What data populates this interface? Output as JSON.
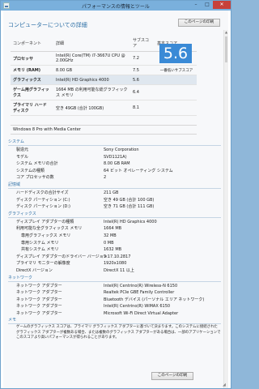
{
  "window": {
    "title": "パフォーマンスの情報とツール",
    "min": "–",
    "max": "□",
    "close": "✕"
  },
  "page": {
    "heading": "コンピューターについての詳細",
    "print_button": "このページの印刷"
  },
  "score_table": {
    "headers": [
      "コンポーネント",
      "詳細",
      "サブスコア",
      "基本スコア"
    ],
    "rows": [
      {
        "component": "プロセッサ",
        "detail": "Intel(R) Core(TM) i7-3667U CPU @ 2.00GHz",
        "score": "7.2"
      },
      {
        "component": "メモリ (RAM)",
        "detail": "8.00 GB",
        "score": "7.5"
      },
      {
        "component": "グラフィックス",
        "detail": "Intel(R) HD Graphics 4000",
        "score": "5.6"
      },
      {
        "component": "ゲーム用グラフィックス",
        "detail": "1664 MB の利用可能な総グラフィックス メモリ",
        "score": "6.4"
      },
      {
        "component": "プライマリ ハード ディスク",
        "detail": "空き 49GB (合計 100GB)",
        "score": "8.1"
      }
    ],
    "base_score": "5.6",
    "base_caption": "一番低いサブスコア",
    "edition": "Windows 8 Pro with Media Center"
  },
  "sections": [
    {
      "title": "システム",
      "rows": [
        {
          "k": "製造元",
          "v": "Sony Corporation"
        },
        {
          "k": "モデル",
          "v": "SVD1121A)"
        },
        {
          "k": "システム メモリの合計",
          "v": "8.00 GB RAM"
        },
        {
          "k": "システムの種類",
          "v": "64 ビット オペレーティング システム"
        },
        {
          "k": "コア プロセッサの数",
          "v": "2"
        }
      ]
    },
    {
      "title": "記憶域",
      "rows": [
        {
          "k": "ハードディスクの合計サイズ",
          "v": "211 GB"
        },
        {
          "k": "ディスク パーティション (C:)",
          "v": "空き 49 GB (合計 100 GB)"
        },
        {
          "k": "ディスク パーティション (D:)",
          "v": "空き 71 GB (合計 111 GB)"
        }
      ]
    },
    {
      "title": "グラフィックス",
      "rows": [
        {
          "k": "ディスプレイ アダプターの種類",
          "v": "Intel(R) HD Graphics 4000"
        },
        {
          "k": "利用可能な全グラフィックス メモリ",
          "v": "1664 MB"
        },
        {
          "k": "専用グラフィックス メモリ",
          "v": "32 MB",
          "sub": true
        },
        {
          "k": "専用システム メモリ",
          "v": "0 MB",
          "sub": true
        },
        {
          "k": "共有システム メモリ",
          "v": "1632 MB",
          "sub": true
        },
        {
          "k": "ディスプレイ アダプターのドライバー バージョン",
          "v": "9.17.10.2817"
        },
        {
          "k": "プライマリ モニターの解像度",
          "v": "1920x1080"
        },
        {
          "k": "DirectX バージョン",
          "v": "DirectX 11 以上"
        }
      ]
    },
    {
      "title": "ネットワーク",
      "rows": [
        {
          "k": "ネットワーク アダプター",
          "v": "Intel(R) Centrino(R) Wireless-N 6150"
        },
        {
          "k": "ネットワーク アダプター",
          "v": "Realtek PCIe GBE Family Controller"
        },
        {
          "k": "ネットワーク アダプター",
          "v": "Bluetooth デバイス (パーソナル エリア ネットワーク)"
        },
        {
          "k": "ネットワーク アダプター",
          "v": "Intel(R) Centrino(R) WiMAX 6150"
        },
        {
          "k": "ネットワーク アダプター",
          "v": "Microsoft Wi-Fi Direct Virtual Adapter"
        }
      ]
    }
  ],
  "memo": {
    "title": "メモ",
    "text": "ゲームのグラフィックス スコアは、プライマリ グラフィックス アダプターに基づいて決まります。このシステムに接続されたグラフィックス アダプターが複数ある場合、または複数のグラフィックス アダプターがある場合は、一部のアプリケーションでこのスコアより高いパフォーマンスが得られることがあります。"
  }
}
